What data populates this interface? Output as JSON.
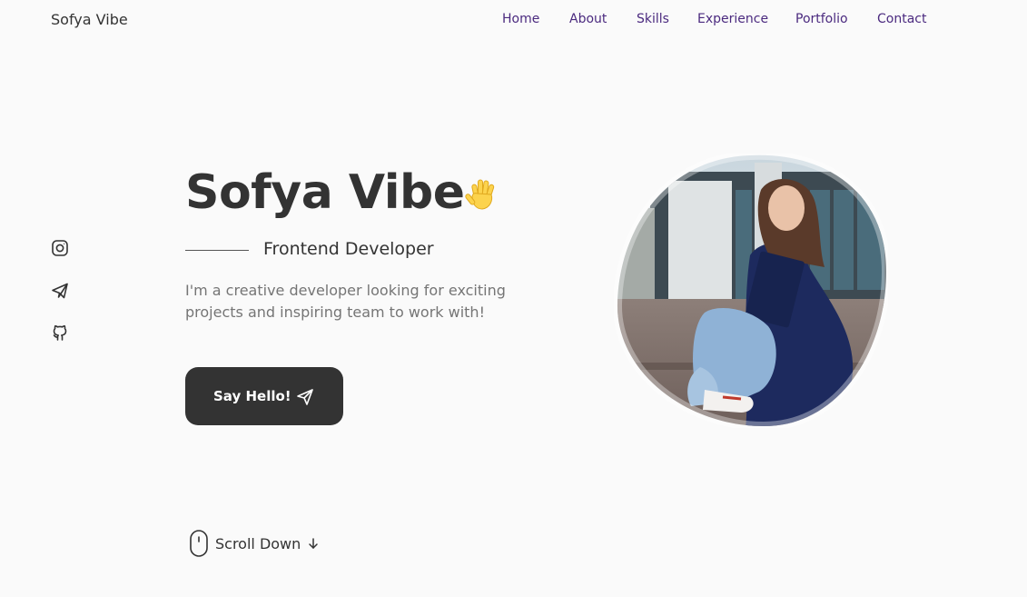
{
  "header": {
    "logo": "Sofya Vibe",
    "nav": [
      {
        "label": "Home"
      },
      {
        "label": "About"
      },
      {
        "label": "Skills"
      },
      {
        "label": "Experience"
      },
      {
        "label": "Portfolio"
      },
      {
        "label": "Contact"
      }
    ]
  },
  "social": [
    {
      "icon": "instagram-icon"
    },
    {
      "icon": "telegram-icon"
    },
    {
      "icon": "github-icon"
    }
  ],
  "hero": {
    "title": "Sofya Vibe",
    "wave_icon": "waving-hand-icon",
    "subtitle": "Frontend Developer",
    "description": "I'm a creative developer looking for exciting projects and inspiring team to work with!",
    "cta_label": "Say Hello!",
    "cta_icon": "send-icon"
  },
  "scroll": {
    "label": "Scroll Down",
    "mouse_icon": "mouse-icon",
    "arrow_icon": "arrow-down-icon"
  },
  "colors": {
    "background": "#fafafa",
    "text": "#333333",
    "nav": "#4b2a7f",
    "muted": "#757575",
    "button": "#333333"
  }
}
